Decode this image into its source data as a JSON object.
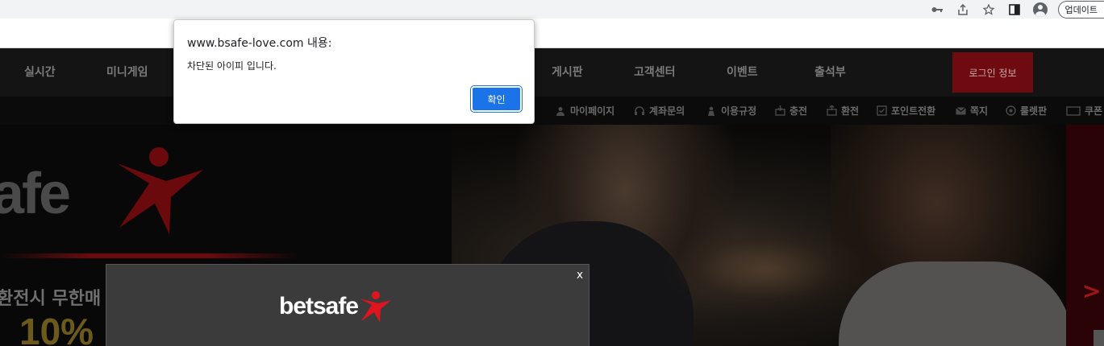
{
  "browser": {
    "update_label": "업데이트",
    "icons": [
      "key-icon",
      "share-icon",
      "star-icon",
      "sidepanel-icon",
      "profile-icon"
    ]
  },
  "nav": {
    "items": [
      {
        "label": "실시간"
      },
      {
        "label": "미니게임"
      },
      {
        "label": "게시판"
      },
      {
        "label": "고객센터"
      },
      {
        "label": "이벤트"
      },
      {
        "label": "출석부"
      }
    ],
    "login_label": "로그인 정보",
    "login_color": "#6e0b10"
  },
  "subnav": {
    "items": [
      {
        "label": "마이페이지",
        "icon": "user-icon"
      },
      {
        "label": "계좌문의",
        "icon": "headset-icon"
      },
      {
        "label": "이용규정",
        "icon": "person-icon"
      },
      {
        "label": "충전",
        "icon": "deposit-icon"
      },
      {
        "label": "환전",
        "icon": "withdraw-icon"
      },
      {
        "label": "포인트전환",
        "icon": "check-icon"
      },
      {
        "label": "쪽지",
        "icon": "mail-icon"
      },
      {
        "label": "룰렛판",
        "icon": "roulette-icon"
      },
      {
        "label": "쿠폰",
        "icon": "coupon-icon"
      }
    ]
  },
  "hero": {
    "brand_fragment": "afe",
    "promo_text": "환전시 무한매",
    "promo_percent": "10%",
    "next_arrow": ">"
  },
  "popup": {
    "close_label": "x",
    "logo_text": "betsafe"
  },
  "alert": {
    "title": "www.bsafe-love.com 내용:",
    "message": "차단된 아이피 입니다.",
    "ok_label": "확인",
    "ok_color": "#1a73e8"
  }
}
